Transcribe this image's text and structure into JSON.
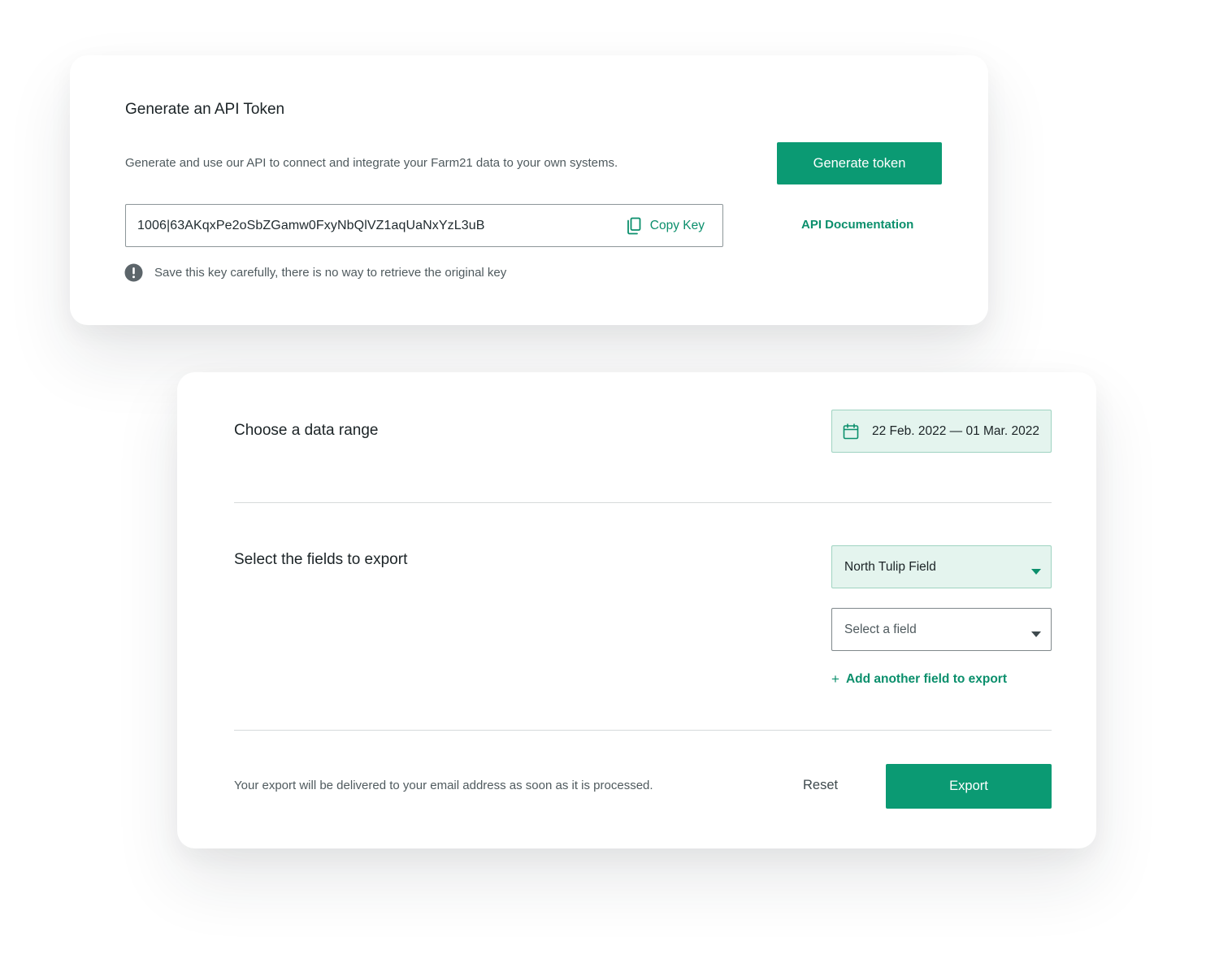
{
  "api_card": {
    "title": "Generate an API Token",
    "description": "Generate and use our API to connect and integrate your Farm21 data to your own systems.",
    "generate_button": "Generate token",
    "api_key": "1006|63AKqxPe2oSbZGamw0FxyNbQlVZ1aqUaNxYzL3uB",
    "copy_label": "Copy Key",
    "copy_icon": "copy-icon",
    "docs_link": "API Documentation",
    "warning_icon": "exclamation-circle-icon",
    "warning_text": "Save this key carefully, there is no way to retrieve the original key"
  },
  "export_card": {
    "date_section_title": "Choose a data range",
    "calendar_icon": "calendar-icon",
    "date_range": "22 Feb. 2022 — 01 Mar. 2022",
    "fields_section_title": "Select the fields to export",
    "farm_select_value": "North Tulip Field",
    "field_select_placeholder": "Select a field",
    "add_field_link": "Add another field to export",
    "add_icon": "+",
    "delivery_note": "Your export will be delivered to your email address as soon as it is processed.",
    "reset_button": "Reset",
    "export_button": "Export"
  },
  "colors": {
    "accent": "#0b9a73",
    "accent_text": "#0b8f6c",
    "accent_soft_bg": "#e4f4ee",
    "accent_soft_border": "#9fd3c1",
    "text_primary": "#1b2326",
    "text_secondary": "#4f5a5e",
    "divider": "#d6dadb",
    "icon_gray": "#5c656a"
  }
}
